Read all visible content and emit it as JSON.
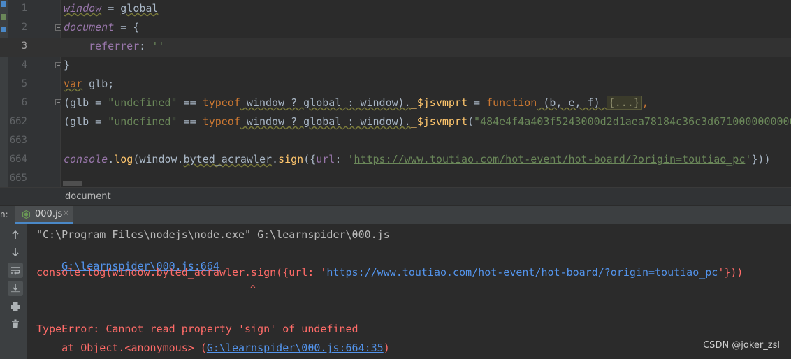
{
  "editor": {
    "lines": [
      {
        "num": "1"
      },
      {
        "num": "2"
      },
      {
        "num": "3"
      },
      {
        "num": "4"
      },
      {
        "num": "5"
      },
      {
        "num": "6"
      },
      {
        "num": "662"
      },
      {
        "num": "663"
      },
      {
        "num": "664"
      },
      {
        "num": "665"
      }
    ],
    "code": {
      "l1_a": "window",
      "l1_b": " = ",
      "l1_c": "global",
      "l2_a": "document",
      "l2_b": " = {",
      "l3_a": "referrer",
      "l3_b": ": ",
      "l3_c": "''",
      "l4": "}",
      "l5_a": "var",
      "l5_b": " glb;",
      "l6_a": "(glb = ",
      "l6_b": "\"undefined\"",
      "l6_c": " == ",
      "l6_d": "typeof",
      "l6_e": " window ? global : window).",
      "l6_f": "_$jsvmprt",
      "l6_g": " = ",
      "l6_h": "function",
      "l6_i": " (b, e, f) ",
      "l6_j": "{...}",
      "l6_k": ",",
      "l662_a": "(glb = ",
      "l662_b": "\"undefined\"",
      "l662_c": " == ",
      "l662_d": "typeof",
      "l662_e": " window ? global : window).",
      "l662_f": "_$jsvmprt",
      "l662_g": "(",
      "l662_h": "\"484e4f4a403f5243000d2d1aea78184c36c3d6710000000000",
      "l664_a": "console",
      "l664_b": ".",
      "l664_c": "log",
      "l664_d": "(window.",
      "l664_e": "byted_acrawler",
      "l664_f": ".",
      "l664_g": "sign",
      "l664_h": "({",
      "l664_i": "url",
      "l664_j": ": ",
      "l664_k": "'",
      "l664_l": "https://www.toutiao.com/hot-event/hot-board/?origin=toutiao_pc",
      "l664_m": "'",
      "l664_n": "}))"
    }
  },
  "breadcrumb": "document",
  "run": {
    "label": "n:",
    "tab_name": "000.js",
    "tab_close": "×"
  },
  "console": {
    "cmd": "\"C:\\Program Files\\nodejs\\node.exe\" G:\\learnspider\\000.js",
    "file_link": "G:\\learnspider\\000.js:664",
    "src_a": "console.log(window.byted_acrawler.sign({url: '",
    "src_link": "https://www.toutiao.com/hot-event/hot-board/?origin=toutiao_pc",
    "src_b": "'}))",
    "caret": "^",
    "error": "TypeError: Cannot read property 'sign' of undefined",
    "at_a": "    at Object.<anonymous> (",
    "at_link": "G:\\learnspider\\000.js:664:35",
    "at_b": ")"
  },
  "watermark": "CSDN @joker_zsl",
  "icons": [
    "arrow-up-icon",
    "arrow-down-icon",
    "soft-wrap-icon",
    "scroll-to-end-icon",
    "print-icon",
    "trash-icon",
    "node-js-icon",
    "fold-icon"
  ],
  "colors": {
    "editor_bg": "#2b2b2b",
    "keyword": "#cc7832",
    "string": "#6a8759",
    "function": "#ffc66d",
    "error": "#ff6b68",
    "link": "#5394ec"
  }
}
